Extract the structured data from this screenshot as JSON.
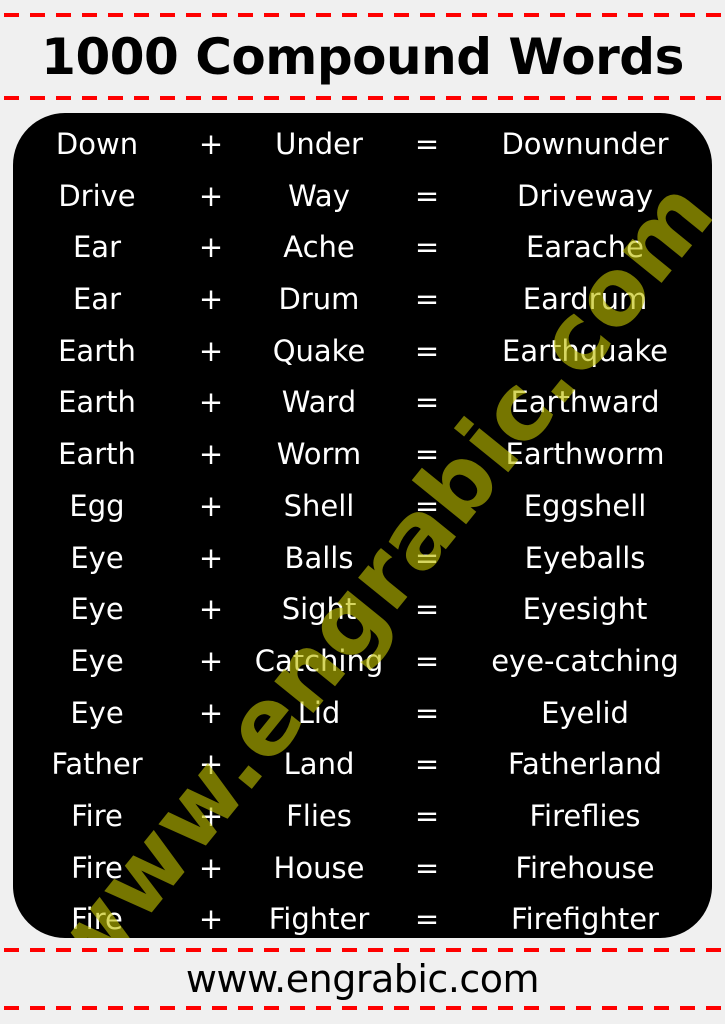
{
  "header": {
    "title": "1000 Compound Words"
  },
  "colors": {
    "background": "#f0f0f0",
    "board": "#000000",
    "dash": "#ff0000",
    "watermark": "#bebe00",
    "text": "#ffffff"
  },
  "operators": {
    "plus": "+",
    "equals": "="
  },
  "rows": [
    {
      "first": "Down",
      "second": "Under",
      "result": "Downunder"
    },
    {
      "first": "Drive",
      "second": "Way",
      "result": "Driveway"
    },
    {
      "first": "Ear",
      "second": "Ache",
      "result": "Earache"
    },
    {
      "first": "Ear",
      "second": "Drum",
      "result": "Eardrum"
    },
    {
      "first": "Earth",
      "second": "Quake",
      "result": "Earthquake"
    },
    {
      "first": "Earth",
      "second": "Ward",
      "result": "Earthward"
    },
    {
      "first": "Earth",
      "second": "Worm",
      "result": "Earthworm"
    },
    {
      "first": "Egg",
      "second": "Shell",
      "result": "Eggshell"
    },
    {
      "first": "Eye",
      "second": "Balls",
      "result": "Eyeballs"
    },
    {
      "first": "Eye",
      "second": "Sight",
      "result": "Eyesight"
    },
    {
      "first": "Eye",
      "second": "Catching",
      "result": "eye-catching"
    },
    {
      "first": "Eye",
      "second": "Lid",
      "result": "Eyelid"
    },
    {
      "first": "Father",
      "second": "Land",
      "result": "Fatherland"
    },
    {
      "first": "Fire",
      "second": "Flies",
      "result": "Fireflies"
    },
    {
      "first": "Fire",
      "second": "House",
      "result": "Firehouse"
    },
    {
      "first": "Fire",
      "second": "Fighter",
      "result": "Firefighter"
    }
  ],
  "watermark": "www.engrabic.com",
  "footer": {
    "website": "www.engrabic.com"
  }
}
